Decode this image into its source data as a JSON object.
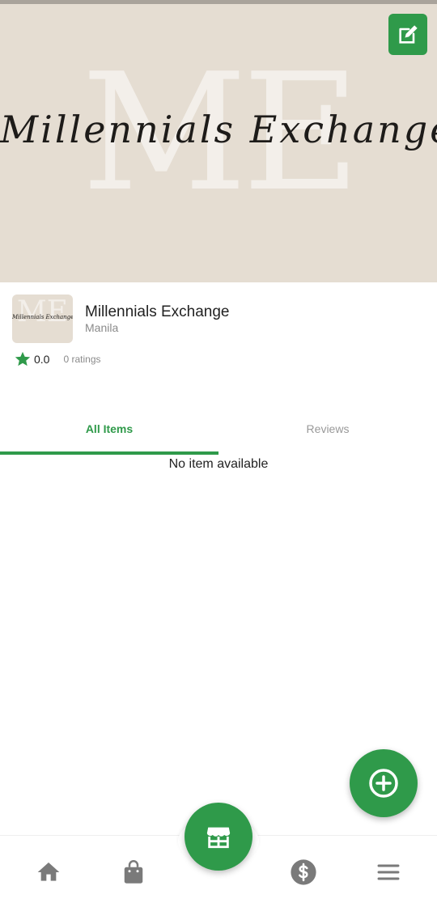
{
  "banner": {
    "monogram": "ME",
    "script_text": "Millennials Exchange"
  },
  "shop": {
    "name": "Millennials Exchange",
    "location": "Manila",
    "rating_value": "0.0",
    "rating_count": "0 ratings"
  },
  "tabs": [
    {
      "label": "All Items",
      "active": true
    },
    {
      "label": "Reviews",
      "active": false
    }
  ],
  "content": {
    "empty_message": "No item available"
  },
  "icons": {
    "edit": "edit-square-icon",
    "star": "star-icon",
    "add": "add-circle-icon",
    "home": "home-icon",
    "bag": "shopping-bag-icon",
    "store": "store-icon",
    "money": "dollar-circle-icon",
    "menu": "menu-icon"
  },
  "colors": {
    "accent": "#2f9a4a",
    "banner_bg": "#e5ddd2",
    "nav_icon": "#7a7a7a"
  }
}
